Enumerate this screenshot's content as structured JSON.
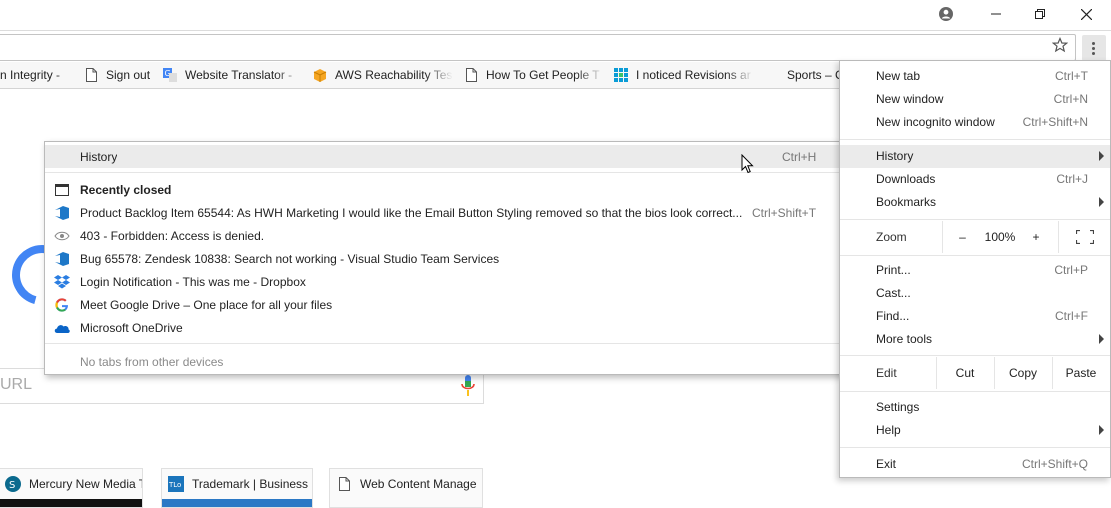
{
  "bookmarks": [
    {
      "label": "n Integrity - ",
      "icon": "none"
    },
    {
      "label": "Sign out",
      "icon": "page-icon"
    },
    {
      "label": "Website Translator - ",
      "icon": "translate-icon"
    },
    {
      "label": "AWS Reachability Tes",
      "icon": "aws-box-icon"
    },
    {
      "label": "How To Get People T",
      "icon": "page-icon"
    },
    {
      "label": "I noticed Revisions ar",
      "icon": "grid-icon"
    },
    {
      "label": "Sports – C",
      "icon": "none"
    }
  ],
  "search": {
    "placeholder_fragment": "URL"
  },
  "tiles": [
    {
      "label": "Mercury New Media T"
    },
    {
      "label": "Trademark | Business"
    },
    {
      "label": "Web Content Manage"
    }
  ],
  "history_menu": {
    "header": {
      "label": "History",
      "shortcut": "Ctrl+H"
    },
    "recently_closed_label": "Recently closed",
    "items": [
      {
        "label": "Product Backlog Item 65544: As HWH Marketing I would like the Email Button Styling removed so that the bios look correct...",
        "shortcut": "Ctrl+Shift+T",
        "icon": "vsts-icon"
      },
      {
        "label": "403 - Forbidden: Access is denied.",
        "shortcut": "",
        "icon": "eye-icon"
      },
      {
        "label": "Bug 65578: Zendesk 10838: Search not working - Visual Studio Team Services",
        "shortcut": "",
        "icon": "vsts-icon"
      },
      {
        "label": "Login Notification - This was me - Dropbox",
        "shortcut": "",
        "icon": "dropbox-icon"
      },
      {
        "label": "Meet Google Drive – One place for all your files",
        "shortcut": "",
        "icon": "google-icon"
      },
      {
        "label": "Microsoft OneDrive",
        "shortcut": "",
        "icon": "onedrive-icon"
      }
    ],
    "other_devices": "No tabs from other devices"
  },
  "main_menu": {
    "new_tab": {
      "label": "New tab",
      "shortcut": "Ctrl+T"
    },
    "new_window": {
      "label": "New window",
      "shortcut": "Ctrl+N"
    },
    "new_incognito": {
      "label": "New incognito window",
      "shortcut": "Ctrl+Shift+N"
    },
    "history": {
      "label": "History"
    },
    "downloads": {
      "label": "Downloads",
      "shortcut": "Ctrl+J"
    },
    "bookmarks": {
      "label": "Bookmarks"
    },
    "zoom": {
      "label": "Zoom",
      "minus": "–",
      "level": "100%",
      "plus": "+"
    },
    "print": {
      "label": "Print...",
      "shortcut": "Ctrl+P"
    },
    "cast": {
      "label": "Cast..."
    },
    "find": {
      "label": "Find...",
      "shortcut": "Ctrl+F"
    },
    "more_tools": {
      "label": "More tools"
    },
    "edit": {
      "label": "Edit",
      "cut": "Cut",
      "copy": "Copy",
      "paste": "Paste"
    },
    "settings": {
      "label": "Settings"
    },
    "help": {
      "label": "Help"
    },
    "exit": {
      "label": "Exit",
      "shortcut": "Ctrl+Shift+Q"
    }
  },
  "colors": {
    "accent": "#4285f4",
    "vsts": "#1e78c8",
    "dropbox": "#2a7de1"
  }
}
